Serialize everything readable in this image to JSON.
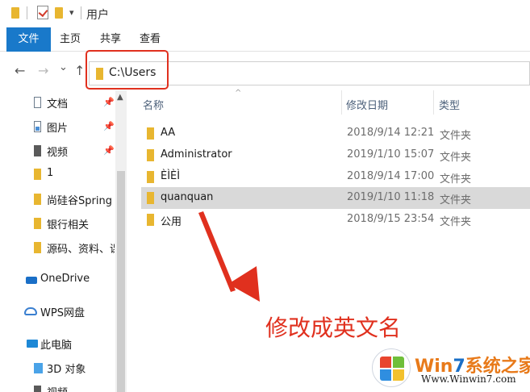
{
  "window": {
    "title": "用户",
    "quick_access_dropdown": "▾"
  },
  "ribbon": {
    "tabs": [
      "文件",
      "主页",
      "共享",
      "查看"
    ]
  },
  "nav": {
    "back": "←",
    "forward": "→",
    "recent": "⌄",
    "up": "↑",
    "address": "C:\\Users"
  },
  "sidebar": {
    "items": [
      {
        "label": "文档",
        "icon": "document-icon",
        "pinned": true
      },
      {
        "label": "图片",
        "icon": "pictures-icon",
        "pinned": true
      },
      {
        "label": "视频",
        "icon": "video-icon",
        "pinned": true
      },
      {
        "label": "1",
        "icon": "folder-icon",
        "pinned": false
      },
      {
        "label": "尚硅谷Spring Bo",
        "icon": "folder-icon",
        "pinned": false
      },
      {
        "label": "银行相关",
        "icon": "folder-icon",
        "pinned": false
      },
      {
        "label": "源码、资料、课件",
        "icon": "folder-icon",
        "pinned": false
      },
      {
        "label": "OneDrive",
        "icon": "onedrive-icon",
        "pinned": false
      },
      {
        "label": "WPS网盘",
        "icon": "wps-cloud-icon",
        "pinned": false
      },
      {
        "label": "此电脑",
        "icon": "this-pc-icon",
        "pinned": false
      },
      {
        "label": "3D 对象",
        "icon": "3d-objects-icon",
        "pinned": false
      },
      {
        "label": "视频",
        "icon": "video-icon",
        "pinned": false
      }
    ],
    "pin_glyph": "📌",
    "scroll_up": "▲"
  },
  "files": {
    "columns": [
      "名称",
      "修改日期",
      "类型"
    ],
    "sort_glyph": "^",
    "rows": [
      {
        "name": "AA",
        "date": "2018/9/14 12:21",
        "type": "文件夹",
        "selected": false
      },
      {
        "name": "Administrator",
        "date": "2019/1/10 15:07",
        "type": "文件夹",
        "selected": false
      },
      {
        "name": "ÈÌÈÌ",
        "date": "2018/9/14 17:00",
        "type": "文件夹",
        "selected": false
      },
      {
        "name": "quanquan",
        "date": "2019/1/10 11:18",
        "type": "文件夹",
        "selected": true
      },
      {
        "name": "公用",
        "date": "2018/9/15 23:54",
        "type": "文件夹",
        "selected": false
      }
    ]
  },
  "annotation": {
    "text": "修改成英文名",
    "color": "#e0301e"
  },
  "watermark": {
    "brand_a": "Win",
    "brand_b": "7",
    "brand_c": "系统之家",
    "url": "Www.Winwin7.com"
  },
  "colors": {
    "accent": "#1979ca",
    "folder": "#e8b630",
    "selection": "#d9d9d9",
    "highlight_red": "#e0301e"
  }
}
